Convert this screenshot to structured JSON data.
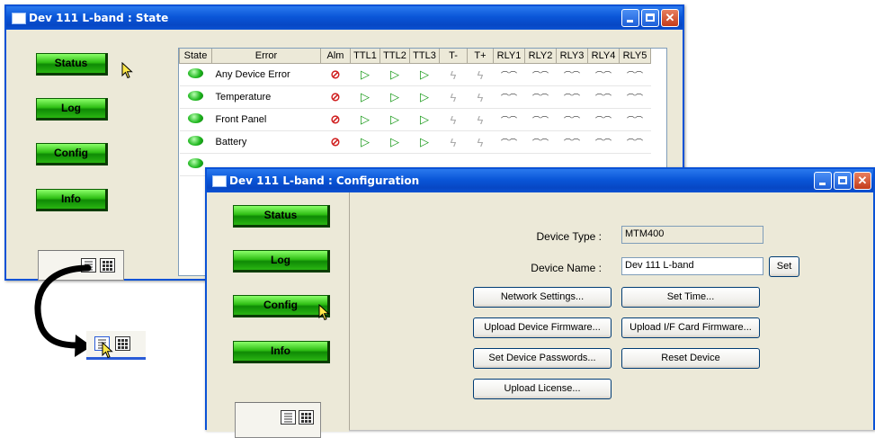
{
  "state_window": {
    "title": "Dev 111 L-band : State",
    "nav": {
      "status": "Status",
      "log": "Log",
      "config": "Config",
      "info": "Info"
    },
    "table": {
      "headers": [
        "State",
        "Error",
        "Alm",
        "TTL1",
        "TTL2",
        "TTL3",
        "T-",
        "T+",
        "RLY1",
        "RLY2",
        "RLY3",
        "RLY4",
        "RLY5"
      ],
      "rows": [
        {
          "error": "Any Device Error"
        },
        {
          "error": "Temperature"
        },
        {
          "error": "Front Panel"
        },
        {
          "error": "Battery"
        }
      ]
    }
  },
  "config_window": {
    "title": "Dev 111 L-band : Configuration",
    "nav": {
      "status": "Status",
      "log": "Log",
      "config": "Config",
      "info": "Info"
    },
    "device_type_label": "Device Type :",
    "device_type_value": "MTM400",
    "device_name_label": "Device Name :",
    "device_name_value": "Dev 111 L-band",
    "set_label": "Set",
    "buttons": {
      "network_settings": "Network Settings...",
      "set_time": "Set Time...",
      "upload_device_firmware": "Upload Device Firmware...",
      "upload_if_card_firmware": "Upload I/F Card Firmware...",
      "set_device_passwords": "Set Device Passwords...",
      "reset_device": "Reset Device",
      "upload_license": "Upload License..."
    }
  },
  "icons": {
    "alarm": "no-alarm-icon",
    "ttl": "ttl-output-icon",
    "trigger": "lightning-icon",
    "relay": "relay-icon",
    "view_list": "list-view-icon",
    "view_grid": "grid-view-icon"
  },
  "colors": {
    "titlebar": "#0a56d8",
    "nav_button": "#2fbf14",
    "led": "#20b820"
  }
}
